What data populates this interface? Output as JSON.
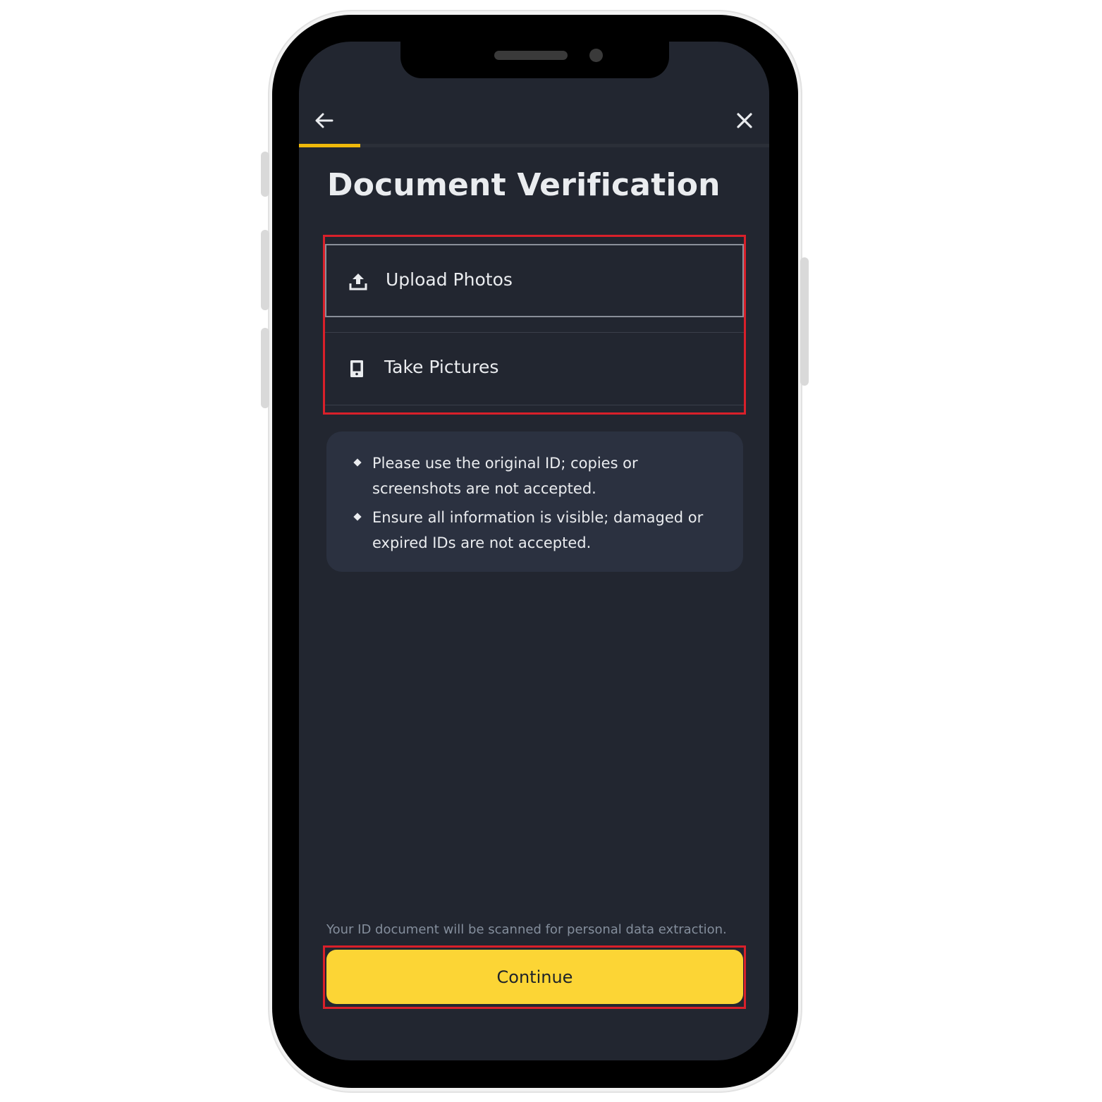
{
  "header": {
    "back_icon": "arrow-left-icon",
    "close_icon": "close-icon",
    "progress_fraction": 0.13,
    "progress_color": "#f0b90b"
  },
  "page": {
    "title": "Document Verification"
  },
  "options": [
    {
      "label": "Upload Photos",
      "icon": "upload-icon"
    },
    {
      "label": "Take Pictures",
      "icon": "camera-icon"
    }
  ],
  "tips": [
    "Please use the original ID; copies or screenshots are not accepted.",
    "Ensure all information is visible; damaged or expired IDs are not accepted."
  ],
  "footer": {
    "disclaimer": "Your ID document will be scanned for personal data extraction.",
    "continue_label": "Continue",
    "button_color": "#fcd535"
  },
  "theme": {
    "background": "#222630",
    "card": "#2b3140",
    "highlight_outline": "#d9202a"
  }
}
